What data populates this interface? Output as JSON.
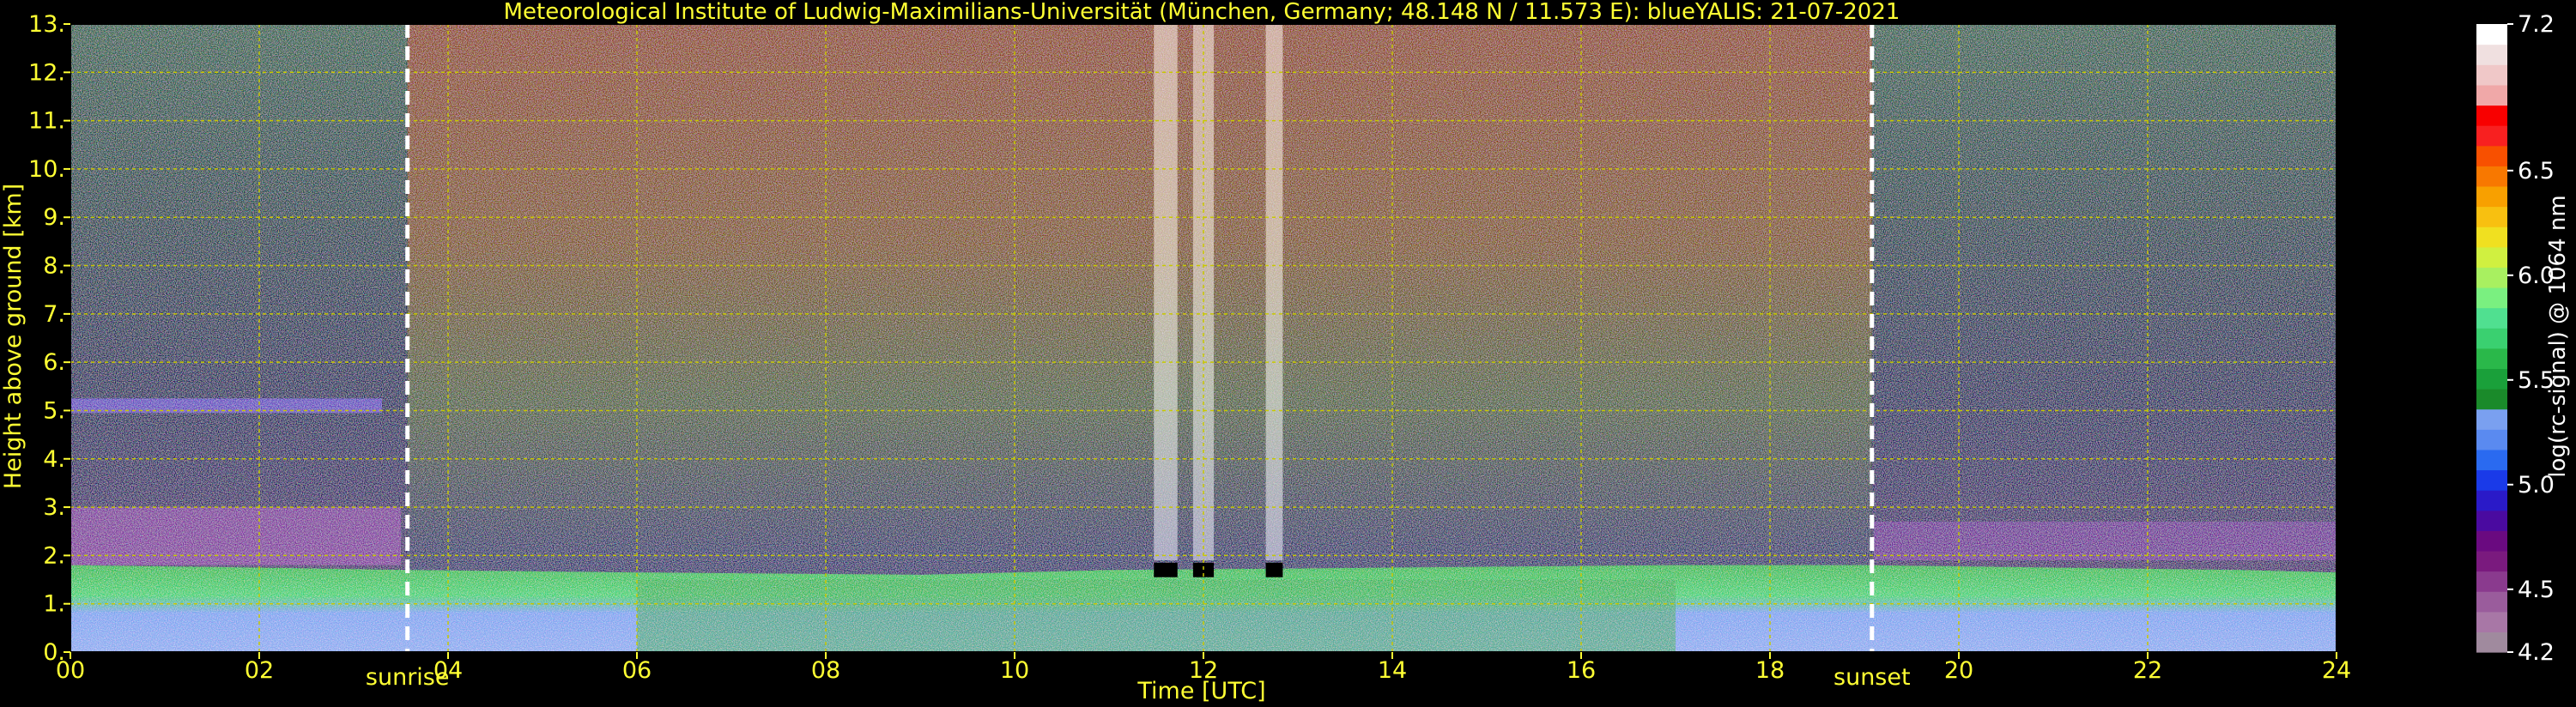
{
  "chart_data": {
    "type": "heatmap",
    "title": "Meteorological Institute of Ludwig-Maximilians-Universität (München, Germany; 48.148 N / 11.573 E):    blueYALIS: 21-07-2021",
    "xlabel": "Time [UTC]",
    "ylabel": "Height above ground [km]",
    "xlim": [
      0,
      24
    ],
    "ylim": [
      0,
      13
    ],
    "x_ticks": [
      0,
      2,
      4,
      6,
      8,
      10,
      12,
      14,
      16,
      18,
      20,
      22,
      24
    ],
    "x_tick_labels": [
      "00",
      "02",
      "04",
      "06",
      "08",
      "10",
      "12",
      "14",
      "16",
      "18",
      "20",
      "22",
      "24"
    ],
    "y_ticks": [
      0,
      1,
      2,
      3,
      4,
      5,
      6,
      7,
      8,
      9,
      10,
      11,
      12,
      13
    ],
    "y_tick_labels": [
      "0.",
      "1.",
      "2.",
      "3.",
      "4.",
      "5.",
      "6.",
      "7.",
      "8.",
      "9.",
      "10.",
      "11.",
      "12.",
      "13."
    ],
    "grid": true,
    "markers": [
      {
        "label": "sunrise",
        "x": 3.57
      },
      {
        "label": "sunset",
        "x": 19.08
      }
    ],
    "colorbar": {
      "label": "log(rc-signal) @ 1064 nm",
      "range": [
        4.2,
        7.2
      ],
      "tick_values": [
        4.2,
        4.5,
        5.0,
        5.5,
        6.0,
        6.5,
        7.2
      ],
      "tick_labels": [
        "4.2",
        "4.5",
        "5.0",
        "5.5",
        "6.0",
        "6.5",
        "7.2"
      ],
      "colors": [
        "#a08a9e",
        "#a877a6",
        "#9a5c9c",
        "#8a3a8e",
        "#7a1a7e",
        "#6a0a80",
        "#4a0aa0",
        "#2a1ac8",
        "#1a3ae8",
        "#2a6af0",
        "#5a8af0",
        "#7aa0f0",
        "#1a8a2a",
        "#1aa03a",
        "#2ab84a",
        "#3ad070",
        "#50e090",
        "#7af080",
        "#a8f060",
        "#d0f040",
        "#f0e020",
        "#f8c010",
        "#f8a000",
        "#f87800",
        "#f85000",
        "#f82020",
        "#f80000",
        "#f0a8a8",
        "#f0c8c8",
        "#f0e0e0",
        "#ffffff"
      ]
    }
  },
  "colors": {
    "text": "#ffff33",
    "grid": "#c8c800",
    "background": "#000000",
    "colorbar_text": "#ffffff",
    "marker_line": "#ffffff"
  }
}
